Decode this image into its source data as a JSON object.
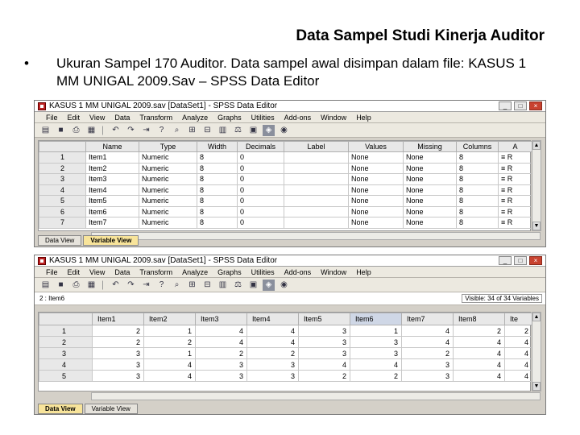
{
  "slide": {
    "title": "Data Sampel Studi Kinerja Auditor",
    "bullet_mark": "•",
    "bullet": "Ukuran Sampel 170 Auditor. Data sampel awal disimpan dalam file: KASUS 1 MM UNIGAL 2009.Sav – SPSS Data Editor"
  },
  "window1": {
    "title": "KASUS 1 MM UNIGAL 2009.sav [DataSet1] - SPSS Data Editor",
    "menu": [
      "File",
      "Edit",
      "View",
      "Data",
      "Transform",
      "Analyze",
      "Graphs",
      "Utilities",
      "Add-ons",
      "Window",
      "Help"
    ],
    "columns": [
      "",
      "Name",
      "Type",
      "Width",
      "Decimals",
      "Label",
      "Values",
      "Missing",
      "Columns",
      "A"
    ],
    "rows": [
      [
        "1",
        "Item1",
        "Numeric",
        "8",
        "0",
        "",
        "None",
        "None",
        "8",
        "≡ R"
      ],
      [
        "2",
        "Item2",
        "Numeric",
        "8",
        "0",
        "",
        "None",
        "None",
        "8",
        "≡ R"
      ],
      [
        "3",
        "Item3",
        "Numeric",
        "8",
        "0",
        "",
        "None",
        "None",
        "8",
        "≡ R"
      ],
      [
        "4",
        "Item4",
        "Numeric",
        "8",
        "0",
        "",
        "None",
        "None",
        "8",
        "≡ R"
      ],
      [
        "5",
        "Item5",
        "Numeric",
        "8",
        "0",
        "",
        "None",
        "None",
        "8",
        "≡ R"
      ],
      [
        "6",
        "Item6",
        "Numeric",
        "8",
        "0",
        "",
        "None",
        "None",
        "8",
        "≡ R"
      ],
      [
        "7",
        "Item7",
        "Numeric",
        "8",
        "0",
        "",
        "None",
        "None",
        "8",
        "≡ R"
      ]
    ],
    "tabs": [
      "Data View",
      "Variable View"
    ]
  },
  "window2": {
    "title": "KASUS 1 MM UNIGAL 2009.sav [DataSet1] - SPSS Data Editor",
    "menu": [
      "File",
      "Edit",
      "View",
      "Data",
      "Transform",
      "Analyze",
      "Graphs",
      "Utilities",
      "Add-ons",
      "Window",
      "Help"
    ],
    "cell_ref": "2 : Item6",
    "visible_label": "Visible: 34 of 34 Variables",
    "columns": [
      "",
      "Item1",
      "Item2",
      "Item3",
      "Item4",
      "Item5",
      "Item6",
      "Item7",
      "Item8",
      "Ite"
    ],
    "rows": [
      [
        "1",
        "2",
        "1",
        "4",
        "4",
        "3",
        "1",
        "4",
        "2",
        "2"
      ],
      [
        "2",
        "2",
        "2",
        "4",
        "4",
        "3",
        "3",
        "4",
        "4",
        "4"
      ],
      [
        "3",
        "3",
        "1",
        "2",
        "2",
        "3",
        "3",
        "2",
        "4",
        "4"
      ],
      [
        "4",
        "3",
        "4",
        "3",
        "3",
        "4",
        "4",
        "3",
        "4",
        "4"
      ],
      [
        "5",
        "3",
        "4",
        "3",
        "3",
        "2",
        "2",
        "3",
        "4",
        "4"
      ]
    ],
    "tabs": [
      "Data View",
      "Variable View"
    ]
  },
  "icons": {
    "open": "folder-icon",
    "save": "save-icon",
    "print": "print-icon",
    "dialog": "dialog-recall-icon",
    "undo": "undo-icon",
    "redo": "redo-icon",
    "goto": "goto-case-icon",
    "vars": "variables-icon",
    "find": "find-icon",
    "insert_case": "insert-case-icon",
    "insert_var": "insert-variable-icon",
    "split": "split-file-icon",
    "weight": "weight-cases-icon",
    "select": "select-cases-icon",
    "value_labels": "value-labels-icon",
    "sets": "use-sets-icon"
  }
}
